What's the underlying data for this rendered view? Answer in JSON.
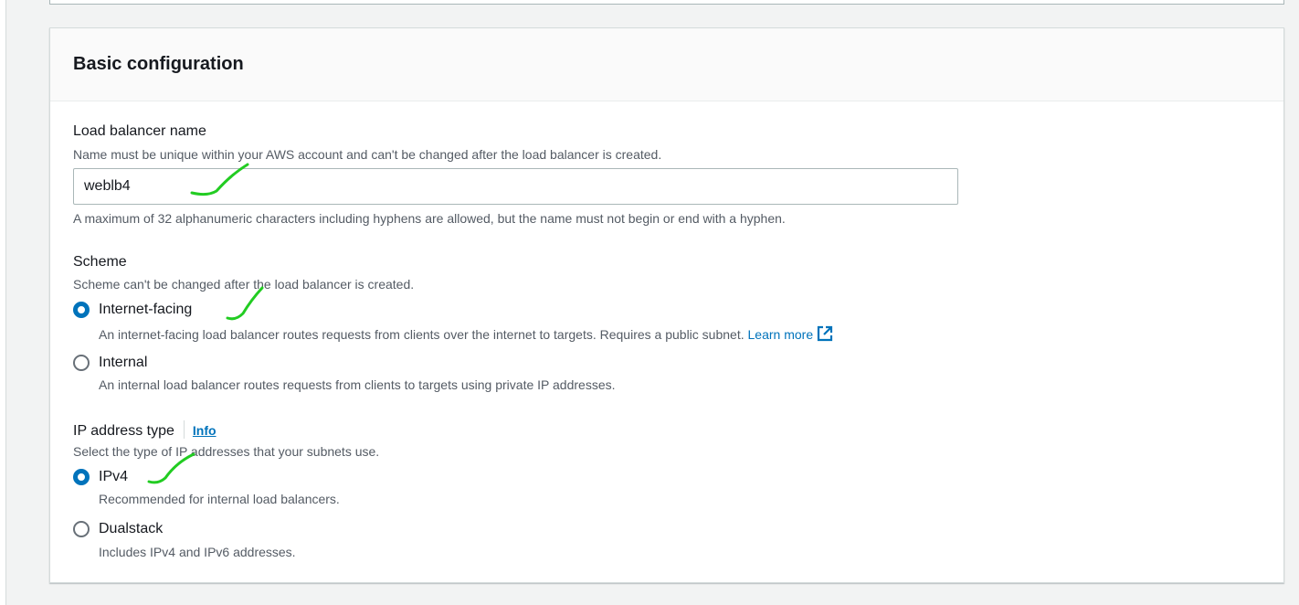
{
  "section": {
    "title": "Basic configuration"
  },
  "lb_name": {
    "label": "Load balancer name",
    "description": "Name must be unique within your AWS account and can't be changed after the load balancer is created.",
    "value": "weblb4",
    "constraint": "A maximum of 32 alphanumeric characters including hyphens are allowed, but the name must not begin or end with a hyphen."
  },
  "scheme": {
    "label": "Scheme",
    "description": "Scheme can't be changed after the load balancer is created.",
    "options": [
      {
        "label": "Internet-facing",
        "description": "An internet-facing load balancer routes requests from clients over the internet to targets. Requires a public subnet.",
        "link": "Learn more",
        "checked": true
      },
      {
        "label": "Internal",
        "description": "An internal load balancer routes requests from clients to targets using private IP addresses.",
        "checked": false
      }
    ]
  },
  "ip_type": {
    "label": "IP address type",
    "info": "Info",
    "description": "Select the type of IP addresses that your subnets use.",
    "options": [
      {
        "label": "IPv4",
        "description": "Recommended for internal load balancers.",
        "checked": true
      },
      {
        "label": "Dualstack",
        "description": "Includes IPv4 and IPv6 addresses.",
        "checked": false
      }
    ]
  },
  "colors": {
    "accent": "#0073bb",
    "annotation": "#22cc22"
  },
  "icons": {
    "external_link": "external-link-icon"
  }
}
